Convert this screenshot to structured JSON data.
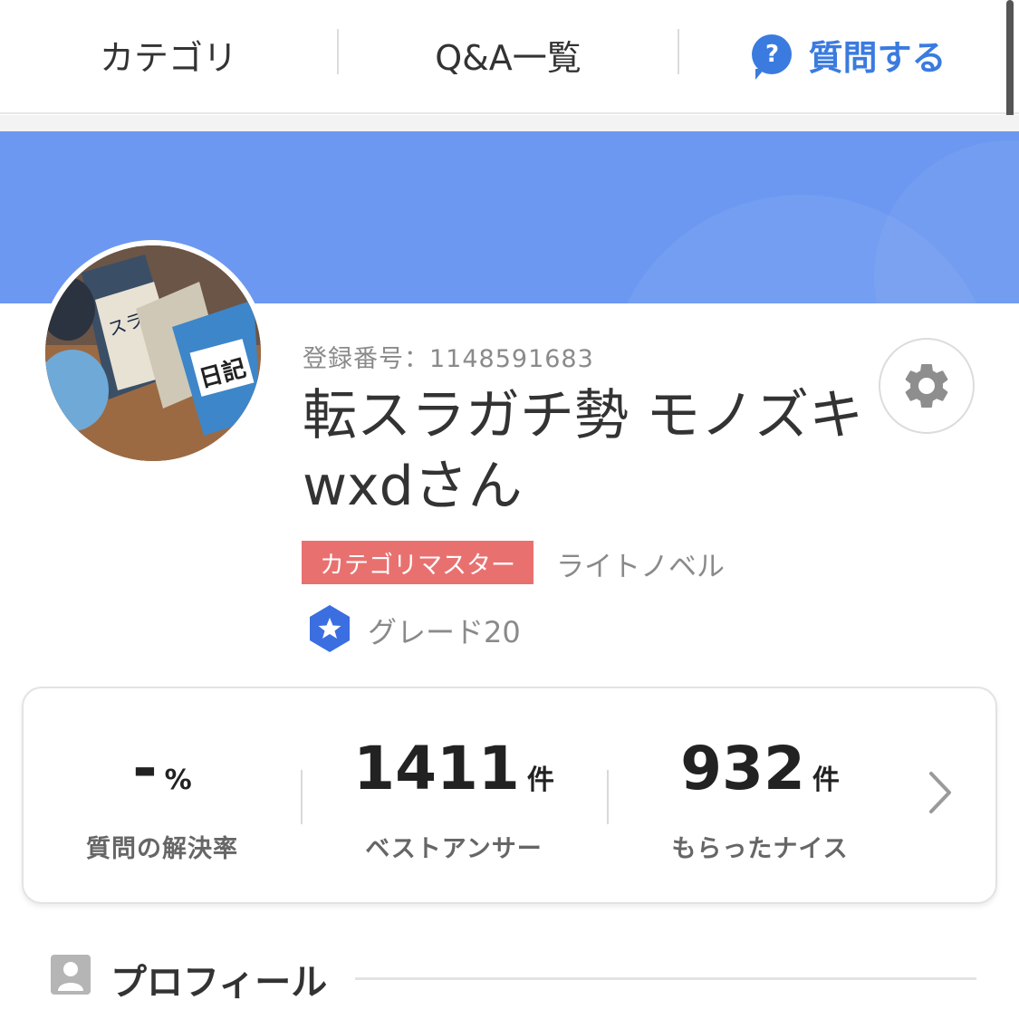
{
  "nav": {
    "category": "カテゴリ",
    "qa_list": "Q&A一覧",
    "ask": "質問する",
    "ask_icon": "question-bubble-icon"
  },
  "profile": {
    "registration": "登録番号：1148591683",
    "username": "転スラガチ勢 モノズキwxdさん",
    "badge": "カテゴリマスター",
    "badge_category": "ライトノベル",
    "grade": "グレード20",
    "colors": {
      "banner": "#6c98f1",
      "accent": "#3b7be0",
      "badge": "#e8716f"
    }
  },
  "stats": {
    "resolve_rate": {
      "value": "-",
      "unit": "%",
      "label": "質問の解決率"
    },
    "best_answer": {
      "value": "1411",
      "unit": "件",
      "label": "ベストアンサー"
    },
    "nice": {
      "value": "932",
      "unit": "件",
      "label": "もらったナイス"
    }
  },
  "section": {
    "title": "プロフィール"
  }
}
